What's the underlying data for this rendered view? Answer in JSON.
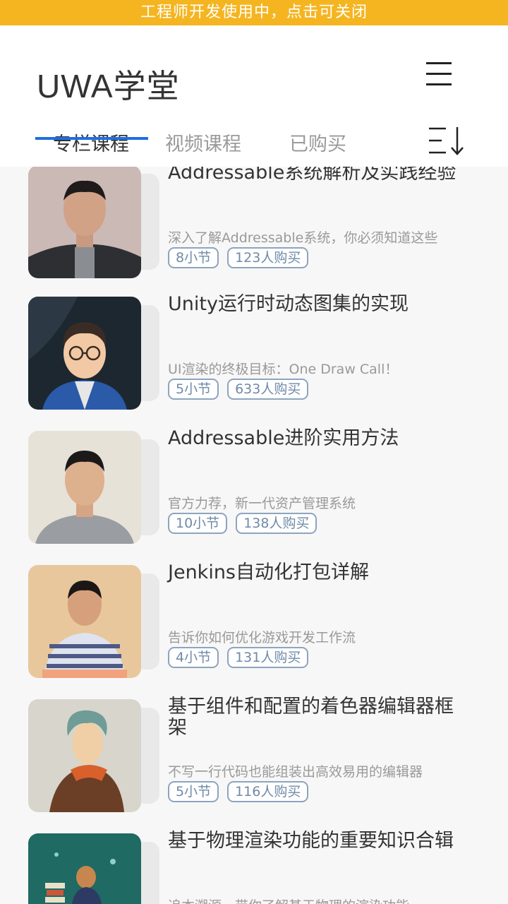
{
  "banner": {
    "text": "工程师开发使用中，点击可关闭"
  },
  "header": {
    "title": "UWA学堂",
    "menu_icon": "hamburger-menu-icon",
    "sort_icon": "sort-descending-icon",
    "tabs": [
      {
        "label": "专栏课程",
        "active": true
      },
      {
        "label": "视频课程",
        "active": false
      },
      {
        "label": "已购买",
        "active": false
      }
    ],
    "accent_color": "#1f6fe0"
  },
  "courses": [
    {
      "title": "Addressable系统解析及实践经验",
      "desc": "深入了解Addressable系统，你必须知道这些",
      "sections": "8小节",
      "buyers": "123人购买"
    },
    {
      "title": "Unity运行时动态图集的实现",
      "desc": "UI渲染的终极目标：One Draw Call！",
      "sections": "5小节",
      "buyers": "633人购买"
    },
    {
      "title": "Addressable进阶实用方法",
      "desc": "官方力荐，新一代资产管理系统",
      "sections": "10小节",
      "buyers": "138人购买"
    },
    {
      "title": "Jenkins自动化打包详解",
      "desc": "告诉你如何优化游戏开发工作流",
      "sections": "4小节",
      "buyers": "131人购买"
    },
    {
      "title": "基于组件和配置的着色器编辑器框架",
      "desc": "不写一行代码也能组装出高效易用的编辑器",
      "sections": "5小节",
      "buyers": "116人购买"
    },
    {
      "title": "基于物理渲染功能的重要知识合辑",
      "desc": "追本溯源，带你了解基于物理的渲染功能",
      "sections": "",
      "buyers": ""
    }
  ],
  "colors": {
    "banner": "#f5b521",
    "tag_border": "#8ea4bd"
  }
}
